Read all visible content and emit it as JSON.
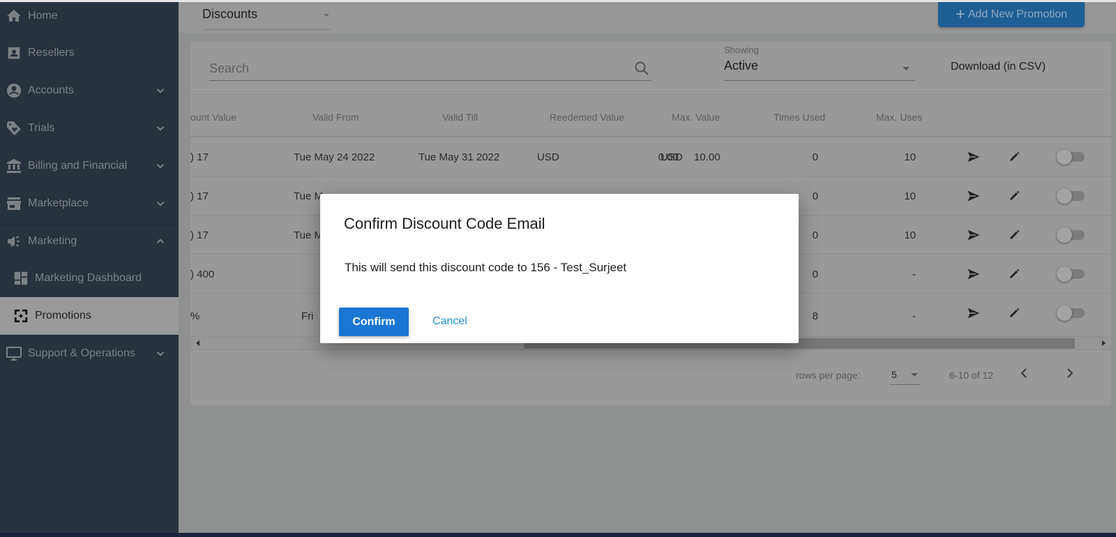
{
  "sidebar": {
    "items": [
      {
        "label": "Home",
        "icon": "home-icon"
      },
      {
        "label": "Resellers",
        "icon": "contact-card-icon"
      },
      {
        "label": "Accounts",
        "icon": "account-circle-icon",
        "expandable": true
      },
      {
        "label": "Trials",
        "icon": "tag-heart-icon",
        "expandable": true
      },
      {
        "label": "Billing and Financial",
        "icon": "bank-icon",
        "expandable": true
      },
      {
        "label": "Marketplace",
        "icon": "storefront-icon",
        "expandable": true
      },
      {
        "label": "Marketing",
        "icon": "megaphone-icon",
        "expandable": true,
        "expanded": true
      },
      {
        "label": "Marketing Dashboard",
        "icon": "dashboard-icon",
        "sub": true
      },
      {
        "label": "Promotions",
        "icon": "promotions-icon",
        "sub": true,
        "active": true
      },
      {
        "label": "Support & Operations",
        "icon": "monitor-icon",
        "expandable": true
      }
    ]
  },
  "header": {
    "type_select": "Discounts",
    "add_button": "Add New Promotion"
  },
  "toolbar": {
    "search_placeholder": "Search",
    "search_value": "",
    "showing_caption": "Showing",
    "showing_value": "Active",
    "download_label": "Download (in CSV)"
  },
  "table": {
    "columns": [
      "ount Value",
      "Valid From",
      "Valid Till",
      "Reedemed Value",
      "Max. Value",
      "Times Used",
      "Max. Uses"
    ],
    "rows": [
      {
        "discount": ") 17",
        "valid_from": "Tue May 24 2022",
        "valid_till": "Tue May 31 2022",
        "redeemed_currency": "USD",
        "redeemed": "0.00",
        "max_currency": "USD",
        "max_value": "10.00",
        "times_used": "0",
        "max_uses": "10",
        "enabled": false
      },
      {
        "discount": ") 17",
        "valid_from": "Tue M",
        "valid_till": "",
        "redeemed_currency": "",
        "redeemed": "",
        "max_currency": "",
        "max_value": "",
        "times_used": "0",
        "max_uses": "10",
        "enabled": false
      },
      {
        "discount": ") 17",
        "valid_from": "Tue M",
        "valid_till": "",
        "redeemed_currency": "",
        "redeemed": "",
        "max_currency": "",
        "max_value": "",
        "times_used": "0",
        "max_uses": "10",
        "enabled": false
      },
      {
        "discount": ") 400",
        "valid_from": "",
        "valid_till": "",
        "redeemed_currency": "",
        "redeemed": "",
        "max_currency": "",
        "max_value": "",
        "times_used": "0",
        "max_uses": "-",
        "enabled": false
      },
      {
        "discount": "%",
        "valid_from": "Fri",
        "valid_till": "",
        "redeemed_currency": "",
        "redeemed": "",
        "max_currency": "",
        "max_value": "",
        "times_used": "8",
        "max_uses": "-",
        "enabled": false
      }
    ]
  },
  "pagination": {
    "rows_label": "rows per page:",
    "rows_value": "5",
    "range": "6-10 of 12"
  },
  "dialog": {
    "title": "Confirm Discount Code Email",
    "message": "This will send this discount code to 156 - Test_Surjeet",
    "confirm_label": "Confirm",
    "cancel_label": "Cancel"
  },
  "colors": {
    "sidebar_bg": "#27323d",
    "primary": "#1976d2",
    "link": "#2592d6"
  }
}
